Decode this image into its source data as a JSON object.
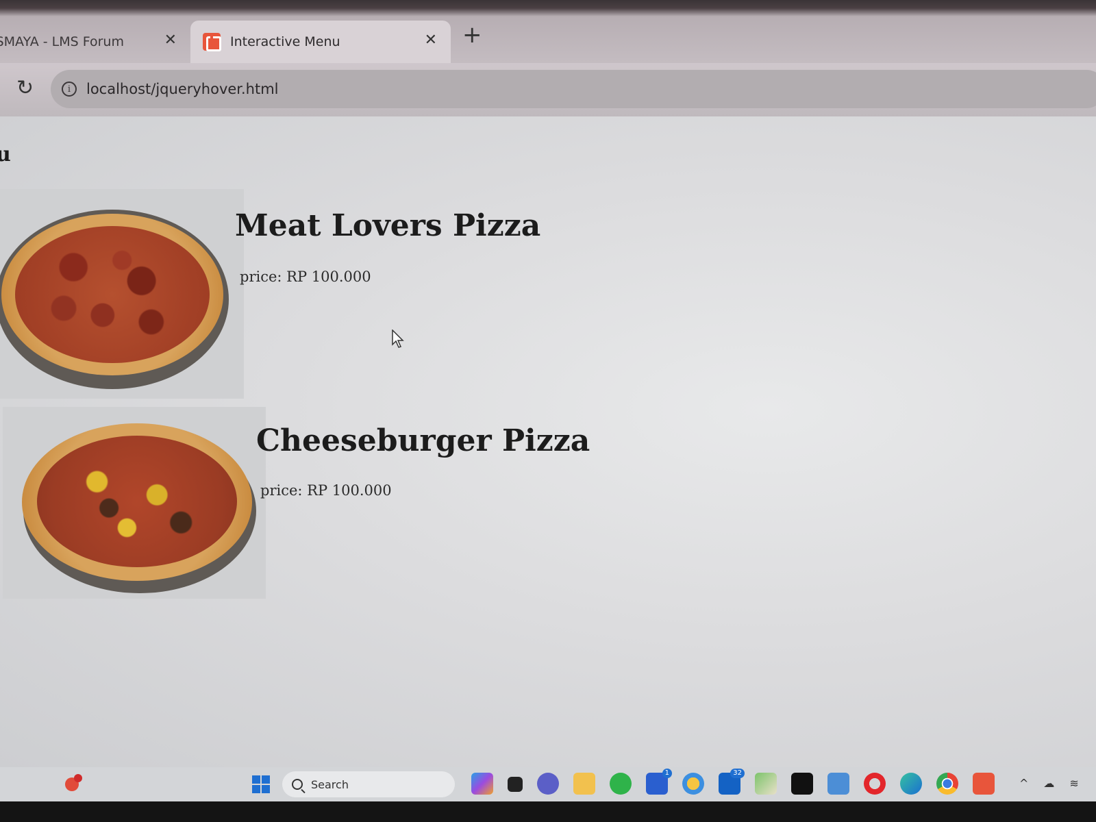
{
  "browser": {
    "tabs": [
      {
        "title": "JSMAYA - LMS Forum",
        "active": false
      },
      {
        "title": "Interactive Menu",
        "active": true
      }
    ],
    "close_glyph": "✕",
    "new_tab_glyph": "+",
    "reload_glyph": "↻",
    "url": "localhost/jqueryhover.html",
    "info_glyph": "i"
  },
  "page": {
    "heading_fragment": "u",
    "items": [
      {
        "name": "Meat Lovers Pizza",
        "price": "price: RP 100.000"
      },
      {
        "name": "Cheeseburger Pizza",
        "price": "price: RP 100.000"
      }
    ]
  },
  "taskbar": {
    "search_label": "Search",
    "badges": {
      "teams": "1",
      "outlook": "32"
    },
    "icons": [
      "windows-start-icon",
      "search-icon",
      "copilot-icon",
      "task-view-icon",
      "chat-icon",
      "file-explorer-icon",
      "whatsapp-icon",
      "store-icon",
      "weather-icon",
      "outlook-icon",
      "paint-icon",
      "terminal-icon",
      "photos-icon",
      "opera-icon",
      "edge-icon",
      "chrome-icon",
      "xampp-icon"
    ],
    "tray": {
      "chevron": "^",
      "cloud": "☁",
      "wifi": "≋"
    }
  },
  "colors": {
    "accent": "#1f6fd1",
    "xampp": "#e8553b"
  }
}
